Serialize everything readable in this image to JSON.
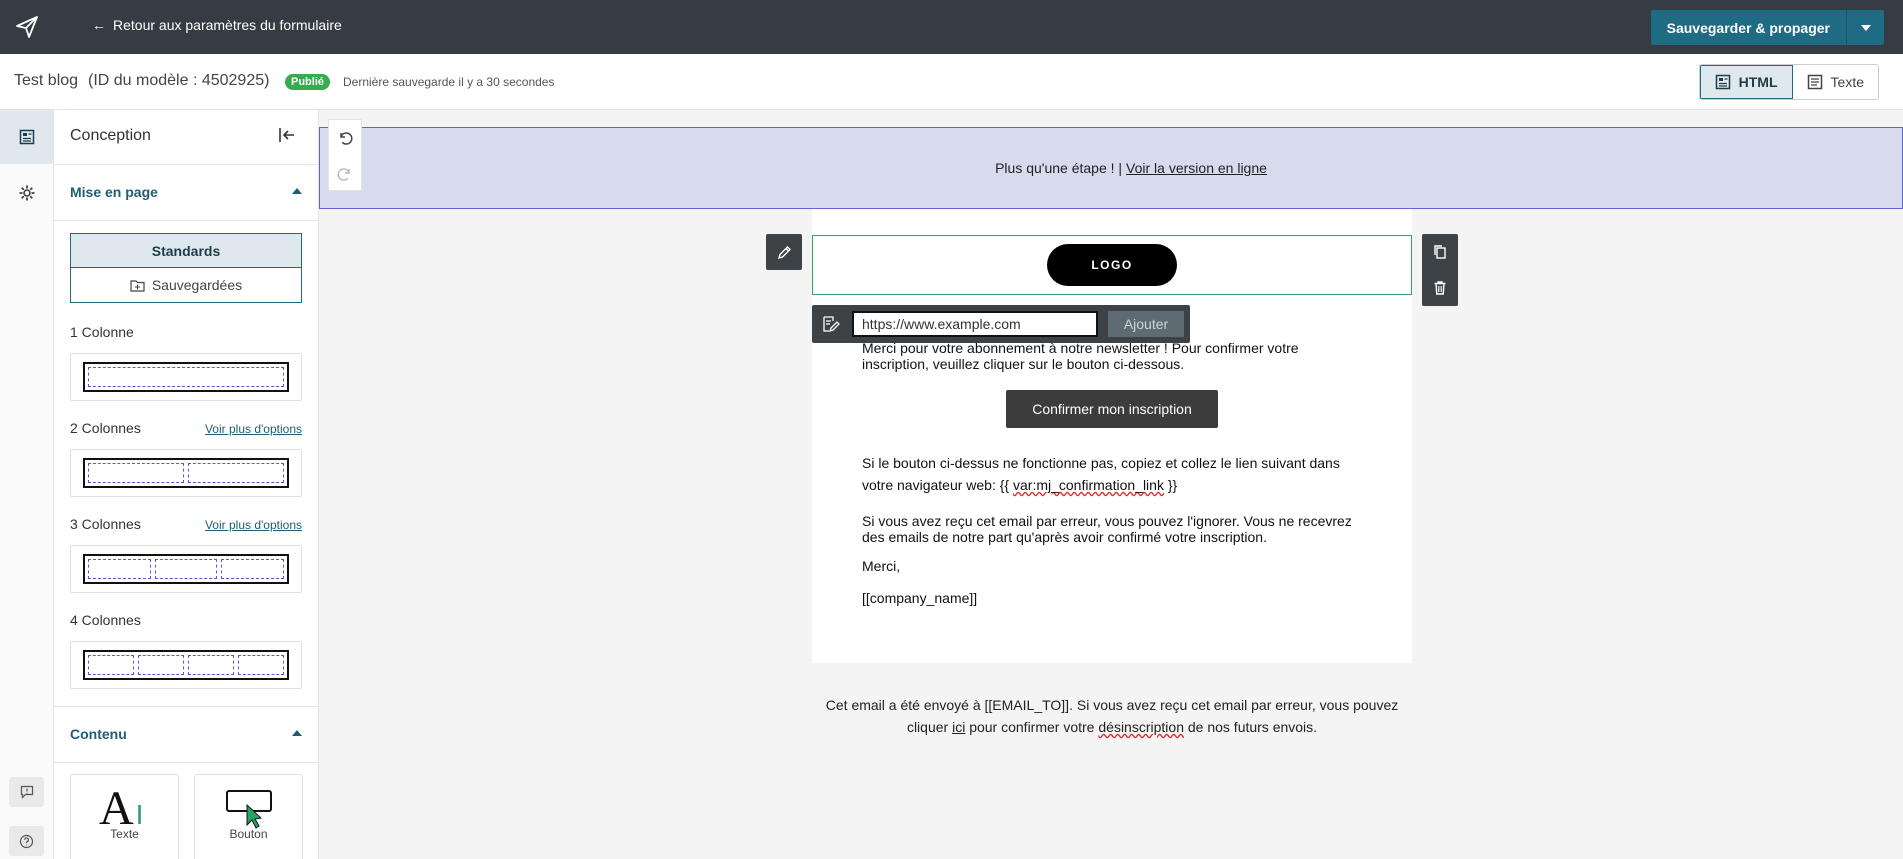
{
  "topbar": {
    "back_label": "Retour aux paramètres du formulaire",
    "save_label": "Sauvegarder & propager"
  },
  "subheader": {
    "template_name": "Test blog",
    "template_id": "(ID du modèle : 4502925)",
    "status": "Publié",
    "last_saved": "Dernière sauvegarde il y a 30 secondes",
    "view_html": "HTML",
    "view_text": "Texte"
  },
  "panel": {
    "title": "Conception",
    "layout_section": "Mise en page",
    "tab_standard": "Standards",
    "tab_saved": "Sauvegardées",
    "one_col": "1 Colonne",
    "two_col": "2 Colonnes",
    "three_col": "3 Colonnes",
    "four_col": "4 Colonnes",
    "more_options": "Voir plus d'options",
    "content_section": "Contenu",
    "tile_text": "Texte",
    "tile_button": "Bouton"
  },
  "email": {
    "preheader_text": "Plus qu'une étape ! |",
    "preheader_link": "Voir la version en ligne",
    "logo": "LOGO",
    "url_value": "https://www.example.com",
    "url_add": "Ajouter",
    "para1": "Merci pour votre abonnement à notre newsletter ! Pour confirmer votre inscription, veuillez cliquer sur le bouton ci-dessous.",
    "confirm_button": "Confirmer mon inscription",
    "para2_a": "Si le bouton ci-dessus ne fonctionne pas, copiez et collez le lien suivant dans votre navigateur web: {{ ",
    "para2_var": "var:mj_confirmation_link",
    "para2_b": " }}",
    "para3": "Si vous avez reçu cet email par erreur, vous pouvez l'ignorer. Vous ne recevrez des emails de notre part qu'après avoir confirmé votre inscription.",
    "thanks": "Merci,",
    "company": "[[company_name]]",
    "footer_a": "Cet email a été envoyé à [[EMAIL_TO]]. Si vous avez reçu cet email par erreur, vous pouvez cliquer ",
    "footer_ici": "ici",
    "footer_b": " pour confirmer votre ",
    "footer_desinscription": "désinscription",
    "footer_c": " de nos futurs envois."
  },
  "colors": {
    "topbar": "#353c43",
    "accent": "#1f6b83",
    "published": "#33ad4d",
    "preheader_bg": "#d8dbed",
    "selection": "#6361d4"
  }
}
